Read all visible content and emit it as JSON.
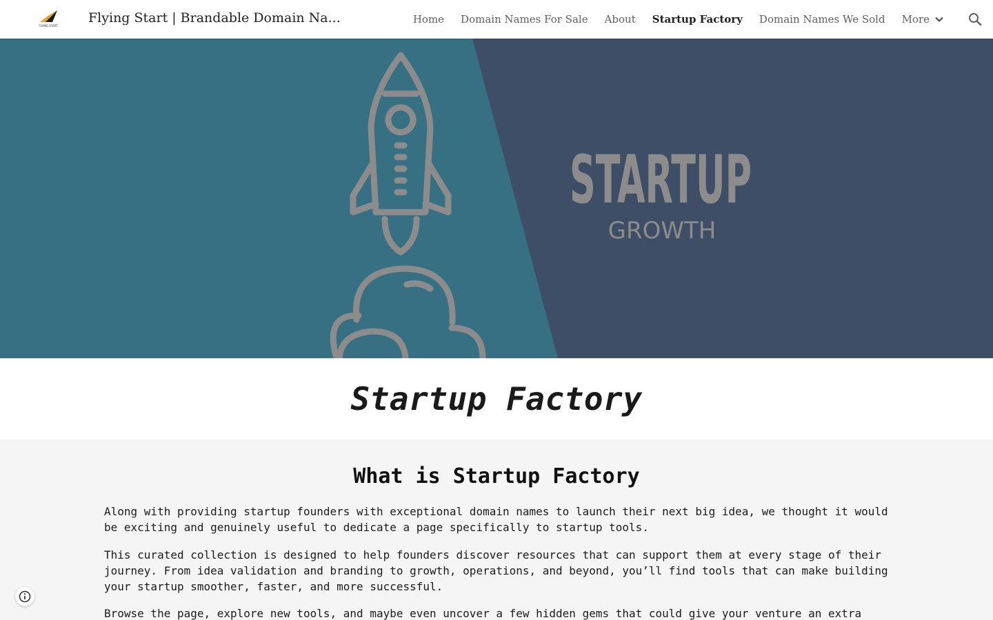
{
  "header": {
    "site_title": "Flying Start | Brandable Domain Na...",
    "logo_text": "FLYING START",
    "nav": [
      {
        "label": "Home",
        "active": false
      },
      {
        "label": "Domain Names For Sale",
        "active": false
      },
      {
        "label": "About",
        "active": false
      },
      {
        "label": "Startup Factory",
        "active": true
      },
      {
        "label": "Domain Names We Sold",
        "active": false
      }
    ],
    "more_label": "More"
  },
  "hero": {
    "headline": "STARTUP",
    "subline": "GROWTH",
    "colors": {
      "left": "#387083",
      "right": "#3e4e66",
      "icon": "#8c8c8c"
    }
  },
  "page": {
    "title": "Startup Factory"
  },
  "content": {
    "heading": "What is Startup Factory",
    "paragraphs": [
      "Along with providing startup founders with exceptional domain names to launch their next big idea, we thought it would be exciting and genuinely useful to dedicate a page specifically to startup tools.",
      "This curated collection is designed to help founders discover resources that can support them at every stage of their journey. From idea validation and branding to growth, operations, and beyond, you’ll find tools that can make building your startup smoother, faster, and more successful.",
      "Browse the page, explore new tools, and maybe even uncover a few hidden gems that could give your venture an extra"
    ]
  }
}
